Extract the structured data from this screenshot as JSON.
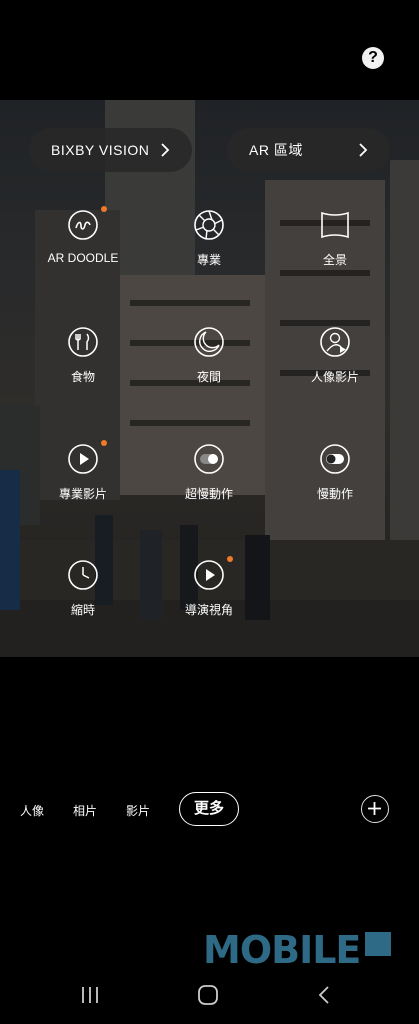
{
  "help": {
    "label": "?"
  },
  "ar": [
    {
      "label": "BIXBY VISION"
    },
    {
      "label": "AR 區域"
    }
  ],
  "modes": {
    "ar_doodle": "AR DOODLE",
    "pro": "專業",
    "panorama": "全景",
    "food": "食物",
    "night": "夜間",
    "portrait_video": "人像影片",
    "pro_video": "專業影片",
    "super_slow_mo": "超慢動作",
    "slow_motion": "慢動作",
    "hyperlapse": "縮時",
    "directors_view": "導演視角"
  },
  "mode_tabs": {
    "portrait": "人像",
    "photo": "相片",
    "video": "影片",
    "more": "更多"
  },
  "watermark": {
    "text": "MOBILE"
  },
  "colors": {
    "accent_dot": "#f07a2a",
    "logo": "#2e6a86"
  },
  "icons": [
    "help-icon",
    "chevron-right-icon",
    "ar-doodle-icon",
    "aperture-icon",
    "panorama-icon",
    "food-icon",
    "moon-icon",
    "portrait-video-icon",
    "play-icon",
    "toggle-icon",
    "timer-icon",
    "plus-icon",
    "recent-apps-icon",
    "home-icon",
    "back-icon"
  ]
}
